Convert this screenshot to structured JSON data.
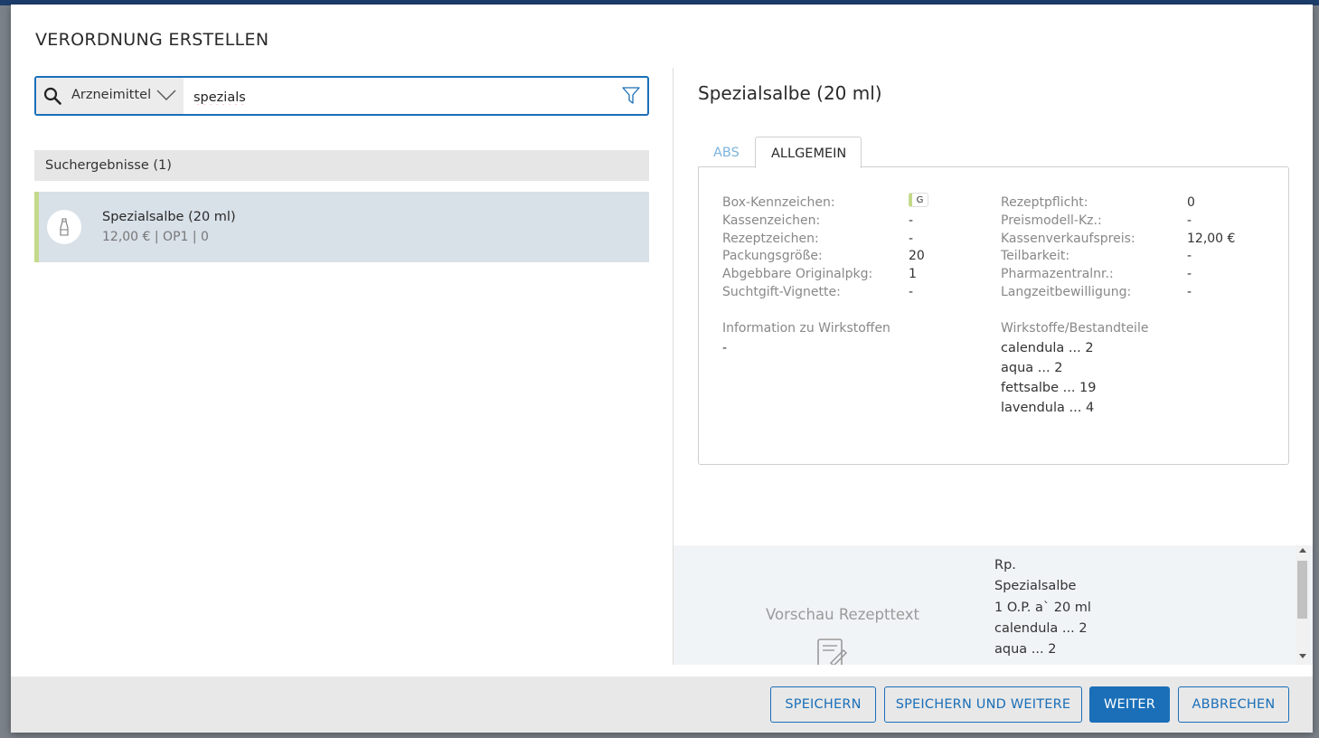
{
  "dialog": {
    "title": "VERORDNUNG ERSTELLEN"
  },
  "search": {
    "category": "Arzneimittel",
    "query": "spezials",
    "icons": {
      "search": "search-icon",
      "dropdown": "chevron-down-icon",
      "filter": "filter-icon"
    }
  },
  "results": {
    "header": "Suchergebnisse (1)",
    "items": [
      {
        "title": "Spezialsalbe (20 ml)",
        "subtitle": "12,00 € | OP1 | 0",
        "icon": "ointment-tube-icon"
      }
    ]
  },
  "detail": {
    "title": "Spezialsalbe (20 ml)",
    "tabs": [
      {
        "label": "ABS",
        "active": false
      },
      {
        "label": "ALLGEMEIN",
        "active": true
      }
    ],
    "left_fields": [
      {
        "label": "Box-Kennzeichen:",
        "value": "G"
      },
      {
        "label": "Kassenzeichen:",
        "value": "-"
      },
      {
        "label": "Rezeptzeichen:",
        "value": "-"
      },
      {
        "label": "Packungsgröße:",
        "value": "20"
      },
      {
        "label": "Abgebbare Originalpkg:",
        "value": "1"
      },
      {
        "label": "Suchtgift-Vignette:",
        "value": "-"
      }
    ],
    "right_fields": [
      {
        "label": "Rezeptpflicht:",
        "value": "0"
      },
      {
        "label": "Preismodell-Kz.:",
        "value": "-"
      },
      {
        "label": "Kassenverkaufspreis:",
        "value": "12,00 €"
      },
      {
        "label": "Teilbarkeit:",
        "value": "-"
      },
      {
        "label": "Pharmazentralnr.:",
        "value": "-"
      },
      {
        "label": "Langzeitbewilligung:",
        "value": "-"
      }
    ],
    "wirkstoff_info": {
      "label": "Information zu Wirkstoffen",
      "value": "-"
    },
    "ingredients": {
      "label": "Wirkstoffe/Bestandteile",
      "items": [
        "calendula ... 2",
        "aqua ... 2",
        "fettsalbe ... 19",
        "lavendula ... 4"
      ]
    }
  },
  "preview": {
    "label": "Vorschau Rezepttext",
    "icon": "prescription-edit-icon",
    "lines": [
      "Rp.",
      "Spezialsalbe",
      "1 O.P. a` 20 ml",
      "calendula ... 2",
      "aqua ... 2"
    ]
  },
  "footer": {
    "save": "SPEICHERN",
    "save_more": "SPEICHERN UND WEITERE",
    "next": "WEITER",
    "cancel": "ABBRECHEN"
  },
  "colors": {
    "accent": "#1a6fb8",
    "highlight": "#c5d98a",
    "selected_bg": "#d8e0e8"
  }
}
